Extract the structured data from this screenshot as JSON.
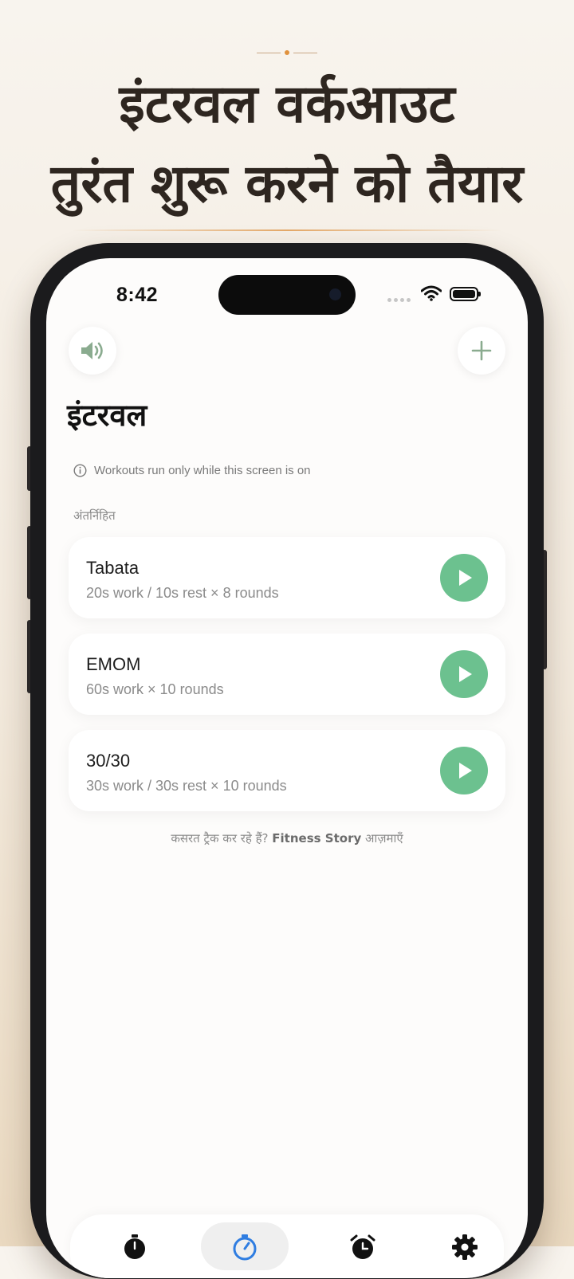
{
  "headline": {
    "line1": "इंटरवल वर्कआउट",
    "line2": "तुरंत शुरू करने को तैयार"
  },
  "status_bar": {
    "time": "8:42"
  },
  "toolbar": {
    "sound_icon": "speaker-icon",
    "add_icon": "plus-icon"
  },
  "page": {
    "title": "इंटरवल",
    "notice": "Workouts run only while this screen is on",
    "section_label": "अंतर्निहित"
  },
  "workouts": [
    {
      "name": "Tabata",
      "detail": "20s work / 10s rest × 8 rounds"
    },
    {
      "name": "EMOM",
      "detail": "60s work × 10 rounds"
    },
    {
      "name": "30/30",
      "detail": "30s work / 30s rest × 10 rounds"
    }
  ],
  "promo": {
    "prefix": "कसरत ट्रैक कर रहे हैं? ",
    "link": "Fitness Story",
    "suffix": " आज़माएँ"
  },
  "tabs": [
    {
      "icon": "stopwatch-icon",
      "active": false
    },
    {
      "icon": "interval-timer-icon",
      "active": true
    },
    {
      "icon": "alarm-clock-icon",
      "active": false
    },
    {
      "icon": "gear-icon",
      "active": false
    }
  ],
  "colors": {
    "accent_green": "#6cc18f",
    "ornament_orange": "#e0923e",
    "icon_green": "#8aab8f"
  }
}
